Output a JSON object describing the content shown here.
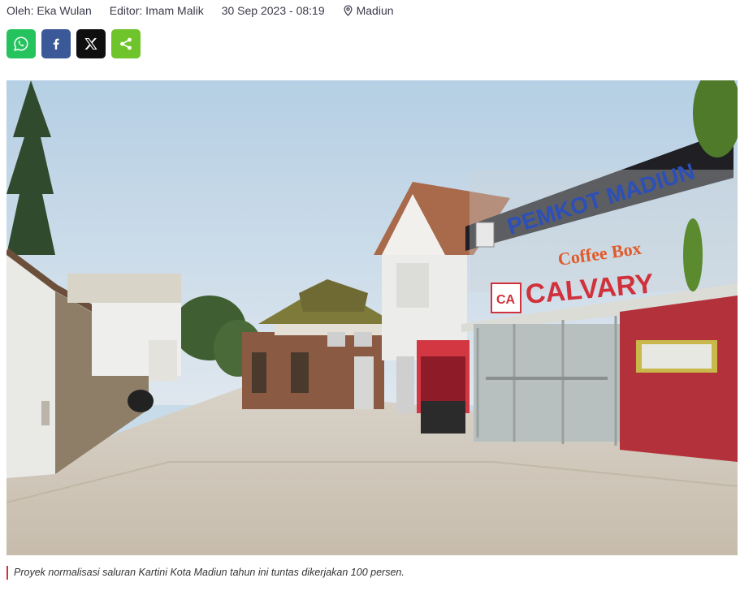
{
  "meta": {
    "author": "Oleh: Eka Wulan",
    "editor": "Editor: Imam Malik",
    "datetime": "30 Sep 2023 - 08:19",
    "location": "Madiun",
    "location_icon": "map-pin-icon"
  },
  "share": [
    {
      "name": "whatsapp",
      "icon": "whatsapp-icon",
      "color": "#25c35e"
    },
    {
      "name": "facebook",
      "icon": "facebook-icon",
      "color": "#3b5998"
    },
    {
      "name": "x",
      "icon": "x-icon",
      "color": "#0f0f0f"
    },
    {
      "name": "share",
      "icon": "share-icon",
      "color": "#6fc42b"
    }
  ],
  "photo": {
    "sign_main": "PEMKOT MADIUN",
    "sign_coffee": "Coffee Box",
    "sign_store": "CALVARY",
    "sign_logo": "CA"
  },
  "caption": "Proyek normalisasi saluran Kartini Kota Madiun tahun ini tuntas dikerjakan 100 persen."
}
